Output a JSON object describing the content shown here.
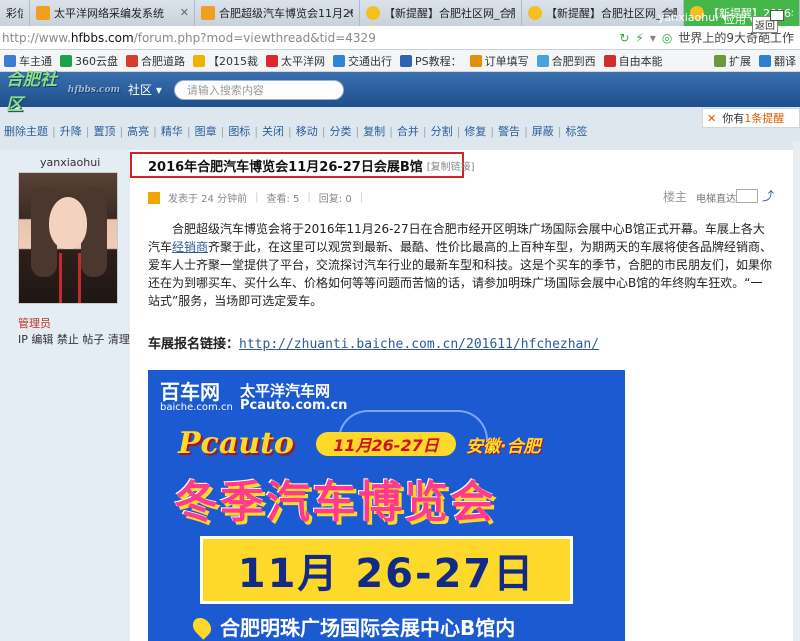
{
  "tabs": [
    {
      "title": "彩信"
    },
    {
      "title": "太平洋网络采编发系统"
    },
    {
      "title": "合肥超级汽车博览会11月26-"
    },
    {
      "title": "【新提醒】合肥社区网_合肥"
    },
    {
      "title": "【新提醒】合肥社区网_合肥"
    },
    {
      "title": "【新提醒】2016年合肥"
    }
  ],
  "address": {
    "prefix": "http://www.",
    "domain": "hfbbs.com",
    "path": "/forum.php?mod=viewthread&tid=4329",
    "search_hint": "世界上的9大奇葩工作"
  },
  "bookmarks": [
    {
      "label": "车主通",
      "color": "#3d7bd8"
    },
    {
      "label": "360云盘",
      "color": "#1aa34a"
    },
    {
      "label": "合肥道路",
      "color": "#d93a2b"
    },
    {
      "label": "【2015裁",
      "color": "#f0b400"
    },
    {
      "label": "太平洋网",
      "color": "#e0262e"
    },
    {
      "label": "交通出行",
      "color": "#2c86d8"
    },
    {
      "label": "PS教程：",
      "color": "#2d62b5"
    },
    {
      "label": "订单填写",
      "color": "#e09000"
    },
    {
      "label": "合肥到西",
      "color": "#47a3e0"
    },
    {
      "label": "自由本能",
      "color": "#d12d2d"
    }
  ],
  "bookmarks_right": {
    "expand": "扩展",
    "translate": "翻译"
  },
  "site": {
    "logo": "合肥社区",
    "logo_sub": "hfbbs.com",
    "section": "社区 ▾",
    "search_placeholder": "请输入搜索内容",
    "user": "yanxiaohui ▾",
    "apps": "应用 ▾",
    "back": "返回",
    "notify_prefix": "你有",
    "notify_count": "1条提醒"
  },
  "admin_tools": [
    "删除主题",
    "升降",
    "置顶",
    "高亮",
    "精华",
    "图章",
    "图标",
    "关闭",
    "移动",
    "分类",
    "复制",
    "合并",
    "分割",
    "修复",
    "警告",
    "屏蔽",
    "标签"
  ],
  "post": {
    "author": "yanxiaohui",
    "role": "管理员",
    "user_actions": "IP 编辑 禁止 帖子 清理",
    "title": "2016年合肥汽车博览会11月26-27日会展B馆",
    "copy_link": "[复制链接]",
    "posted": "发表于 24 分钟前",
    "views": "查看: 5",
    "replies": "回复: 0",
    "floor": "楼主",
    "jump_label": "电梯直达",
    "body_before_link": "合肥超级汽车博览会将于2016年11月26-27日在合肥市经开区明珠广场国际会展中心B馆正式开幕。车展上各大汽车",
    "body_link": "经销商",
    "body_after_link": "齐聚于此，在这里可以观赏到最新、最酷、性价比最高的上百种车型，为期两天的车展将使各品牌经销商、爱车人士齐聚一堂提供了平台，交流探讨汽车行业的最新车型和科技。这是个买车的季节，合肥的市民朋友们，如果你还在为到哪买车、买什么车、价格如何等等问题而苦恼的话，请参加明珠广场国际会展中心B馆的年终购车狂欢。“一站式”服务，当场即可选定爱车。",
    "reg_label": "车展报名链接：",
    "reg_url": "http://zhuanti.baiche.com.cn/201611/hfchezhan/"
  },
  "banner": {
    "brand1": "百车网",
    "brand1_site": "baiche.com.cn",
    "brand2": "太平洋汽车网",
    "brand2_site": "Pcauto.com.cn",
    "pcauto": "Pcauto",
    "date_pill": "11月26-27日",
    "location": "安徽·合肥",
    "headline": "冬季汽车博览会",
    "date_big": "11月 26-27日",
    "venue": "合肥明珠广场国际会展中心B馆内"
  }
}
